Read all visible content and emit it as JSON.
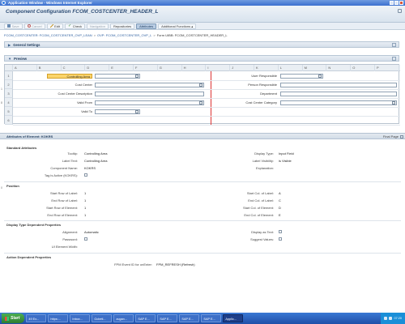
{
  "window": {
    "title": "Application Window - Windows Internet Explorer"
  },
  "app": {
    "title": "Component Configuration FCOM_COSTCENTER_HEADER_L"
  },
  "toolbar": {
    "buttons": [
      {
        "label": "Save",
        "icon": "save-icon",
        "state": "disabled"
      },
      {
        "label": "Cancel",
        "icon": "cancel-icon",
        "state": "disabled"
      },
      {
        "label": "Edit",
        "icon": "edit-icon",
        "state": "normal"
      },
      {
        "label": "Check",
        "icon": "check-icon",
        "state": "normal"
      },
      {
        "label": "Navigation",
        "icon": "",
        "state": "disabled"
      },
      {
        "label": "Repositories",
        "icon": "",
        "state": "normal"
      },
      {
        "label": "Attributes",
        "icon": "",
        "state": "active"
      },
      {
        "label": "Additional Functions ▴",
        "icon": "",
        "state": "normal"
      }
    ]
  },
  "breadcrumb": {
    "items": [
      "FCOM_COSTCENTER: FCOM_COSTCENTER_OVP_LEAN",
      "OVP: FCOM_COSTCENTER_OVP_L",
      "Form UIBB: FCOM_COSTCENTER_HEADER_L"
    ],
    "separator": ">"
  },
  "sections": {
    "general": "General Settings",
    "preview": "Preview"
  },
  "preview": {
    "columns": [
      "A",
      "B",
      "C",
      "D",
      "E",
      "F",
      "G",
      "H",
      "I",
      "J",
      "K",
      "L",
      "M",
      "N",
      "O",
      "P"
    ],
    "rows": [
      "1",
      "2",
      "3",
      "4",
      "5",
      "6"
    ],
    "fields_left": [
      {
        "label": "Controlling Area",
        "highlight": true,
        "f4": true,
        "wide": false
      },
      {
        "label": "Cost Center",
        "highlight": false,
        "f4": true,
        "wide": true
      },
      {
        "label": "Cost Center Description",
        "highlight": false,
        "f4": false,
        "wide": true
      },
      {
        "label": "Valid From",
        "highlight": false,
        "f4": true,
        "wide": true
      },
      {
        "label": "Valid To",
        "highlight": false,
        "f4": true,
        "wide": false
      }
    ],
    "fields_right": [
      {
        "label": "User Responsible",
        "f4": true,
        "wide": false
      },
      {
        "label": "Person Responsible",
        "f4": false,
        "wide": true
      },
      {
        "label": "Department",
        "f4": false,
        "wide": true
      },
      {
        "label": "Cost Center Category",
        "f4": true,
        "wide": true
      }
    ]
  },
  "attributes": {
    "header": "Attributes of Element: KOKRS",
    "final_page": "Final Page",
    "standard": {
      "title": "Standard Attributes",
      "tooltip_label": "Tooltip:",
      "tooltip_value": "Controlling Area",
      "label_text_label": "Label Text:",
      "label_text_value": "Controlling Area",
      "component_name_label": "Component Name:",
      "component_name_value": "KOKRS",
      "tag_active_label": "Tag is Active (KOKRS):",
      "display_type_label": "Display Type:",
      "display_type_value": "Input Field",
      "label_visibility_label": "Label Visibility:",
      "label_visibility_value": "is Visible",
      "explanation_label": "Explanation:"
    },
    "position": {
      "title": "Position",
      "start_row_label_label": "Start Row of Label:",
      "start_row_label_value": "1",
      "end_row_label_label": "End Row of Label:",
      "end_row_label_value": "1",
      "start_row_element_label": "Start Row of Element:",
      "start_row_element_value": "1",
      "end_row_element_label": "End Row of Element:",
      "end_row_element_value": "1",
      "start_col_label_label": "Start Col. of Label:",
      "start_col_label_value": "A",
      "end_col_label_label": "End Col. of Label:",
      "end_col_label_value": "C",
      "start_col_element_label": "Start Col. of Element:",
      "start_col_element_value": "D",
      "end_col_element_label": "End Col. of Element:",
      "end_col_element_value": "E"
    },
    "display_type": {
      "title": "Display Type Dependent Properties",
      "alignment_label": "Alignment:",
      "alignment_value": "Automatic",
      "password_label": "Password:",
      "ui_width_label": "UI Element Width:",
      "display_as_text_label": "Display as Text:",
      "suggest_values_label": "Suggest Values:"
    },
    "action": {
      "title": "Action Dependent Properties",
      "fpm_event_label": "FPM Event ID for onEnter:",
      "fpm_event_value": "FPM_REFRESH (Refresh)"
    }
  },
  "taskbar": {
    "start": "Start",
    "tasks": [
      "49 Ex...",
      "https:...",
      "Inbox...",
      "Gcbeti...",
      "zugan...",
      "SAP E...",
      "SAP E...",
      "SAP E...",
      "SAP E...",
      "Applic..."
    ],
    "active_index": 9,
    "clock": "07:20"
  },
  "colors": {
    "accent": "#2a4a73",
    "highlight": "#fbd46b",
    "divider": "#dd3333"
  }
}
